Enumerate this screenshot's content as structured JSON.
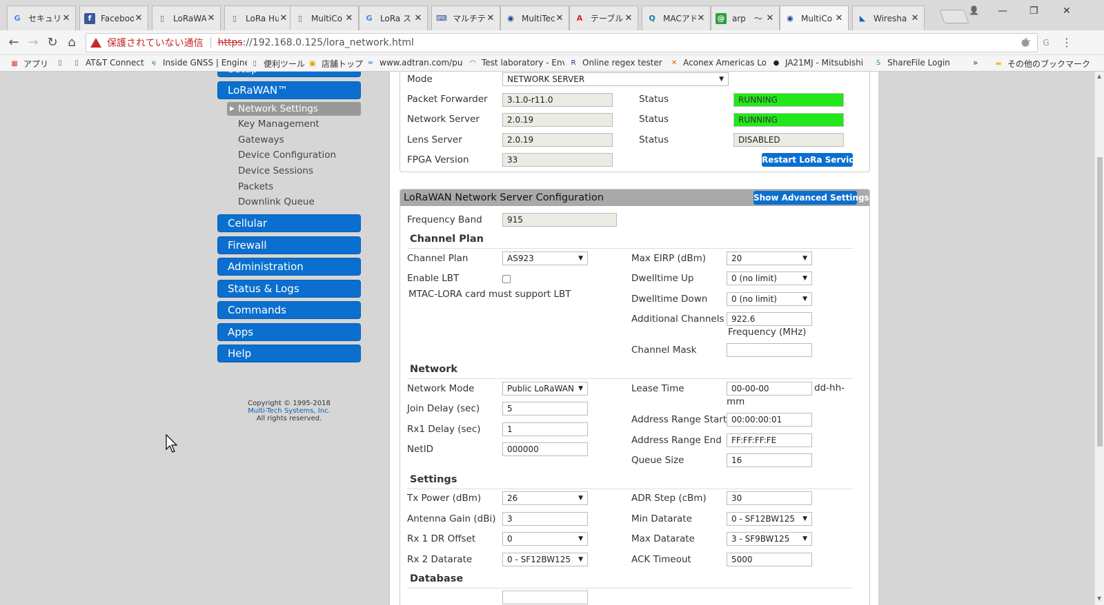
{
  "browser": {
    "tabs": [
      {
        "label": "セキュリテ",
        "icon": "google-icon"
      },
      {
        "label": "Faceboo",
        "icon": "facebook-icon"
      },
      {
        "label": "LoRaWA",
        "icon": "page-icon"
      },
      {
        "label": "LoRa Hu",
        "icon": "page-icon"
      },
      {
        "label": "MultiCo",
        "icon": "page-icon"
      },
      {
        "label": "LoRa ス",
        "icon": "google-icon"
      },
      {
        "label": "マルチテ",
        "icon": "keyboard-icon"
      },
      {
        "label": "MultiTec",
        "icon": "circle-icon"
      },
      {
        "label": "テーブルを",
        "icon": "adobe-icon"
      },
      {
        "label": "MACアド",
        "icon": "q-icon"
      },
      {
        "label": "arp　〜",
        "icon": "at-icon"
      },
      {
        "label": "MultiCo",
        "icon": "circle-icon"
      },
      {
        "label": "Wiresha",
        "icon": "fin-icon"
      }
    ],
    "address": {
      "warning": "保護されていない通信",
      "scheme": "https",
      "rest": "://192.168.0.125/lora_network.html"
    },
    "bookmarks": [
      {
        "label": "アプリ",
        "icon": "apps-grid-icon"
      },
      {
        "label": "",
        "icon": "page-icon"
      },
      {
        "label": "AT&T Connect",
        "icon": "page-icon"
      },
      {
        "label": "Inside GNSS | Engine",
        "icon": "swirl-icon"
      },
      {
        "label": "便利ツール",
        "icon": "page-icon"
      },
      {
        "label": "店舗トップ",
        "icon": "store-icon"
      },
      {
        "label": "www.adtran.com/pub",
        "icon": "adtran-icon"
      },
      {
        "label": "Test laboratory - Envi",
        "icon": "wifi-icon"
      },
      {
        "label": "Online regex tester ar",
        "icon": "regex-icon"
      },
      {
        "label": "Aconex Americas Log",
        "icon": "x-logo-icon"
      },
      {
        "label": "JA21MJ - Mitsubishi",
        "icon": "github-icon"
      },
      {
        "label": "ShareFile Login",
        "icon": "sharefile-icon"
      },
      {
        "label": "»",
        "icon": ""
      },
      {
        "label": "その他のブックマーク",
        "icon": "folder-icon"
      }
    ]
  },
  "sidebar": {
    "top_partial": "Setup",
    "lorawan": "LoRaWAN™",
    "sub_items": [
      "Network Settings",
      "Key Management",
      "Gateways",
      "Device Configuration",
      "Device Sessions",
      "Packets",
      "Downlink Queue"
    ],
    "menu": [
      "Cellular",
      "Firewall",
      "Administration",
      "Status & Logs",
      "Commands",
      "Apps",
      "Help"
    ],
    "copyright_line1": "Copyright © 1995-2018",
    "copyright_company": "Multi-Tech Systems, Inc.",
    "copyright_line3": "All rights reserved."
  },
  "status_panel": {
    "mode_label": "Mode",
    "mode_value": "NETWORK SERVER",
    "packet_forwarder_label": "Packet Forwarder",
    "packet_forwarder_value": "3.1.0-r11.0",
    "network_server_label": "Network Server",
    "network_server_value": "2.0.19",
    "lens_server_label": "Lens Server",
    "lens_server_value": "2.0.19",
    "fpga_label": "FPGA Version",
    "fpga_value": "33",
    "status_label": "Status",
    "pf_status": "RUNNING",
    "ns_status": "RUNNING",
    "lens_status": "DISABLED",
    "restart_button": "Restart LoRa Services"
  },
  "config_panel": {
    "title": "LoRaWAN Network Server Configuration",
    "advanced_button": "Show Advanced Settings",
    "frequency_band_label": "Frequency Band",
    "frequency_band_value": "915",
    "channel_plan_section": "Channel Plan",
    "channel_plan_label": "Channel Plan",
    "channel_plan_value": "AS923",
    "enable_lbt_label": "Enable LBT",
    "lbt_note": "MTAC-LORA card must support LBT",
    "max_eirp_label": "Max EIRP (dBm)",
    "max_eirp_value": "20",
    "dwell_up_label": "Dwelltime Up",
    "dwell_up_value": "0 (no limit)",
    "dwell_down_label": "Dwelltime Down",
    "dwell_down_value": "0 (no limit)",
    "additional_channels_label": "Additional Channels",
    "additional_channels_value": "922.6",
    "frequency_mhz": "Frequency (MHz)",
    "channel_mask_label": "Channel Mask",
    "channel_mask_value": "",
    "network_section": "Network",
    "network_mode_label": "Network Mode",
    "network_mode_value": "Public LoRaWAN",
    "join_delay_label": "Join Delay (sec)",
    "join_delay_value": "5",
    "rx1_delay_label": "Rx1 Delay (sec)",
    "rx1_delay_value": "1",
    "netid_label": "NetID",
    "netid_value": "000000",
    "lease_time_label": "Lease Time",
    "lease_time_value": "00-00-00",
    "lease_unit_a": "dd-hh-",
    "lease_unit_b": "mm",
    "addr_start_label": "Address Range Start",
    "addr_start_value": "00:00:00:01",
    "addr_end_label": "Address Range End",
    "addr_end_value": "FF:FF:FF:FE",
    "queue_size_label": "Queue Size",
    "queue_size_value": "16",
    "settings_section": "Settings",
    "tx_power_label": "Tx Power (dBm)",
    "tx_power_value": "26",
    "antenna_gain_label": "Antenna Gain (dBi)",
    "antenna_gain_value": "3",
    "rx1_dr_offset_label": "Rx 1 DR Offset",
    "rx1_dr_offset_value": "0",
    "rx2_datarate_label": "Rx 2 Datarate",
    "rx2_datarate_value": "0 - SF12BW125",
    "adr_step_label": "ADR Step (cBm)",
    "adr_step_value": "30",
    "min_datarate_label": "Min Datarate",
    "min_datarate_value": "0 - SF12BW125",
    "max_datarate_label": "Max Datarate",
    "max_datarate_value": "3 - SF9BW125",
    "ack_timeout_label": "ACK Timeout",
    "ack_timeout_value": "5000",
    "database_section": "Database"
  }
}
